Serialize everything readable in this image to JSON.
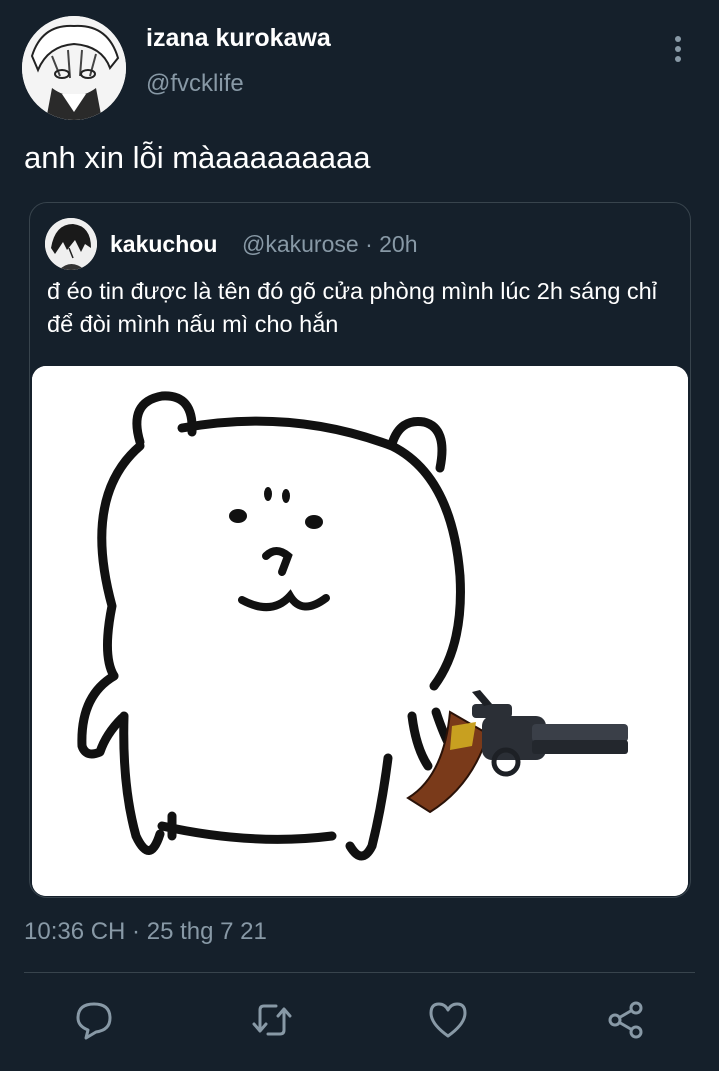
{
  "tweet": {
    "display_name": "izana kurokawa",
    "handle": "@fvcklife",
    "text": "anh xin lỗi màaaaaaaaaa",
    "timestamp": "10:36 CH · 25 thg 7 21"
  },
  "quoted": {
    "display_name": "kakuchou",
    "handle": "@kakurose",
    "time_ago": "20h",
    "separator": " · ",
    "text": "đ éo tin được là tên đó gõ cửa phòng mình lúc 2h sáng chỉ để đòi mình nấu mì cho hắn"
  },
  "icons": {
    "more": "more-vertical-icon",
    "reply": "reply-icon",
    "retweet": "retweet-icon",
    "like": "heart-icon",
    "share": "share-icon"
  },
  "colors": {
    "background": "#15202b",
    "secondary_text": "#8899a6",
    "border": "#38444d"
  }
}
